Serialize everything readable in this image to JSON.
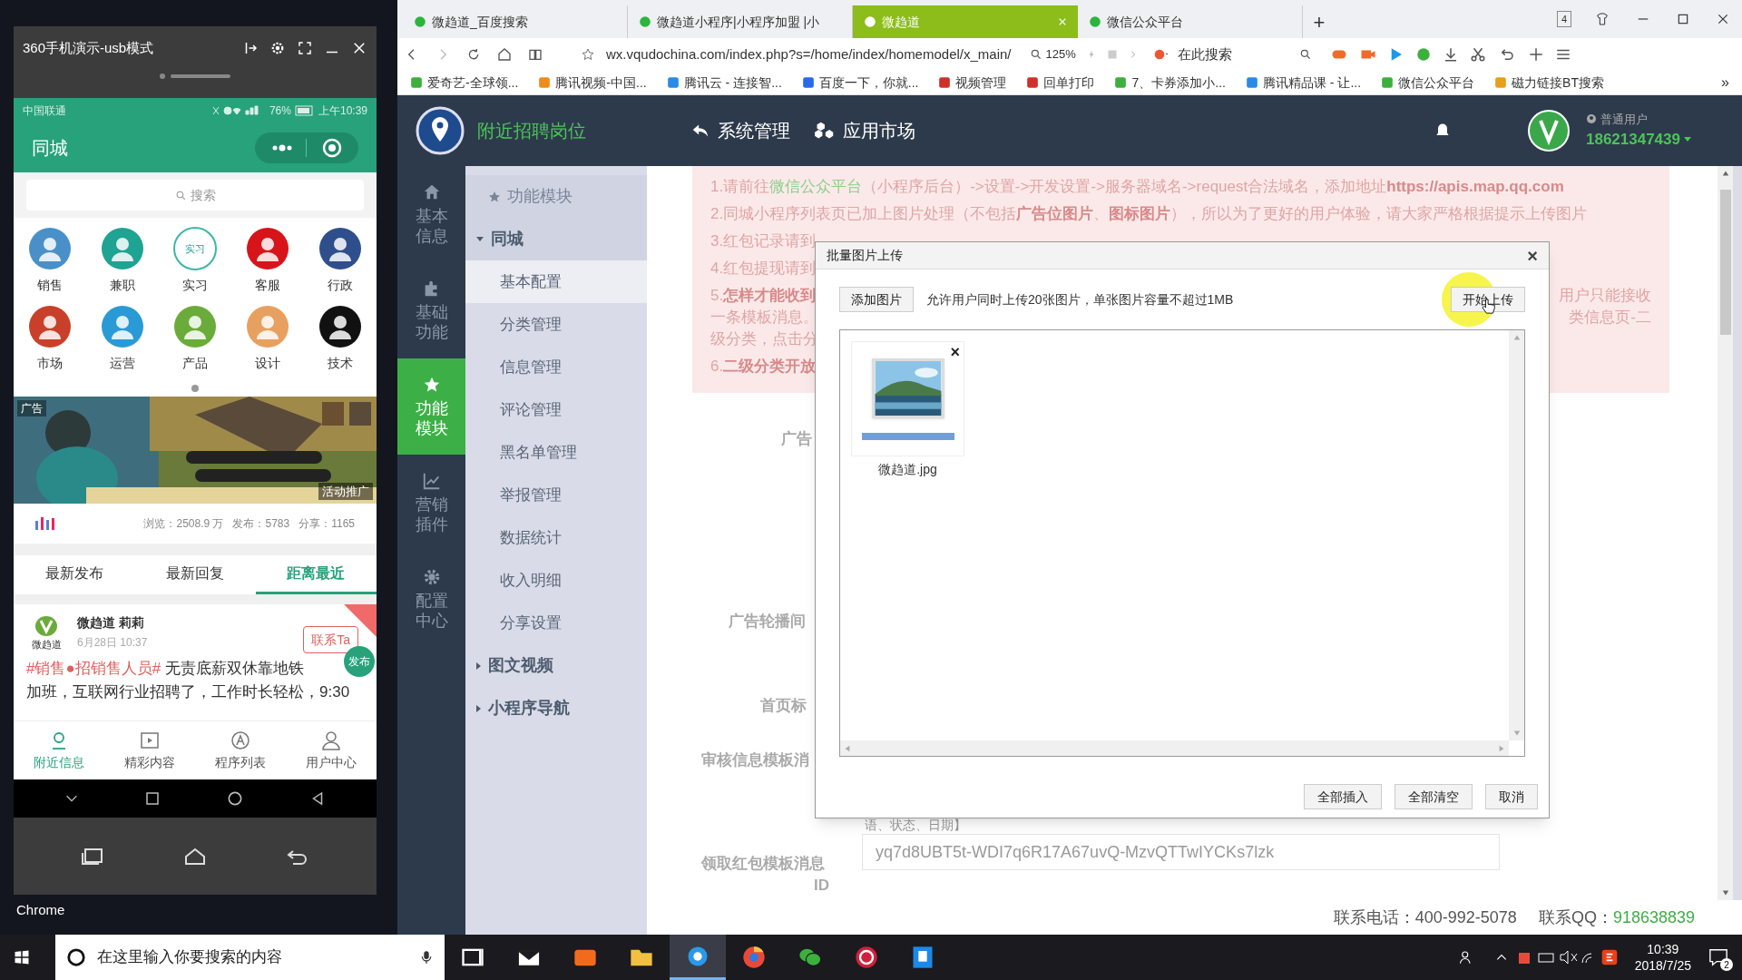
{
  "desktop": {
    "icon_labels": [
      "Chrome"
    ]
  },
  "phone_window": {
    "title": "360手机演示-usb模式",
    "status_bar": {
      "carrier": "中国联通",
      "battery": "76%",
      "time": "上午10:39"
    },
    "app_title": "同城",
    "search": {
      "placeholder": "搜索"
    },
    "categories": [
      {
        "label": "销售"
      },
      {
        "label": "兼职"
      },
      {
        "label": "实习",
        "icon_text": "实习"
      },
      {
        "label": "客服"
      },
      {
        "label": "行政"
      },
      {
        "label": "市场"
      },
      {
        "label": "运营"
      },
      {
        "label": "产品"
      },
      {
        "label": "设计"
      },
      {
        "label": "技术"
      }
    ],
    "banner": {
      "kind": "picture",
      "ad_label": "广告",
      "promo_label": "活动推广"
    },
    "stats": "浏览：2508.9 万   发布：5783   分享：1165",
    "tabs": [
      {
        "label": "最新发布",
        "selected": false
      },
      {
        "label": "最新回复",
        "selected": false
      },
      {
        "label": "距离最近",
        "selected": true
      }
    ],
    "post": {
      "logo_caption": "微趋道",
      "author": "微趋道 莉莉",
      "time": "6月28日 10:37",
      "contact_button": "联系Ta",
      "tag": "#销售●招销售人员#",
      "text_line_1": " 无责底薪双休靠地铁",
      "text_line_2": "加班，互联网行业招聘了，工作时长轻松，9:30"
    },
    "fab": "发布",
    "bottom_nav": [
      {
        "label": "附近信息",
        "selected": true
      },
      {
        "label": "精彩内容",
        "selected": false
      },
      {
        "label": "程序列表",
        "selected": false
      },
      {
        "label": "用户中心",
        "selected": false
      }
    ]
  },
  "browser": {
    "tabs": [
      {
        "title": "微趋道_百度搜索",
        "selected": false
      },
      {
        "title": "微趋道小程序|小程序加盟 |小",
        "selected": false
      },
      {
        "title": "微趋道",
        "selected": true
      },
      {
        "title": "微信公众平台",
        "selected": false
      }
    ],
    "new_tab": "+",
    "tab_count": "4",
    "url": "wx.vqudochina.com/index.php?s=/home/index/homemodel/x_main/",
    "zoom": "125%",
    "search_placeholder": "在此搜索",
    "bookmarks": [
      "爱奇艺-全球领...",
      "腾讯视频-中国...",
      "腾讯云 - 连接智...",
      "百度一下，你就...",
      "视频管理",
      "回单打印",
      "7、卡券添加小...",
      "腾讯精品课 - 让...",
      "微信公众平台",
      "磁力链接BT搜索"
    ],
    "bookmarks_more": "»"
  },
  "admin": {
    "brand": "附近招聘岗位",
    "top_nav": [
      "系统管理",
      "应用市场"
    ],
    "user_role": "普通用户",
    "user_phone": "18621347439",
    "side_nav": [
      {
        "label": "基本信息",
        "selected": false
      },
      {
        "label": "基础功能",
        "selected": false
      },
      {
        "label": "功能模块",
        "selected": true
      },
      {
        "label": "营销插件",
        "selected": false
      },
      {
        "label": "配置中心",
        "selected": false
      }
    ],
    "sub_nav": {
      "title": "功能模块",
      "groups": [
        {
          "label": "同城",
          "expanded": true,
          "children": [
            {
              "label": "基本配置",
              "selected": true
            },
            {
              "label": "分类管理",
              "selected": false
            },
            {
              "label": "信息管理",
              "selected": false
            },
            {
              "label": "评论管理",
              "selected": false
            },
            {
              "label": "黑名单管理",
              "selected": false
            },
            {
              "label": "举报管理",
              "selected": false
            },
            {
              "label": "数据统计",
              "selected": false
            },
            {
              "label": "收入明细",
              "selected": false
            },
            {
              "label": "分享设置",
              "selected": false
            }
          ]
        },
        {
          "label": "图文视频",
          "expanded": false
        },
        {
          "label": "小程序导航",
          "expanded": false
        }
      ]
    },
    "notices": [
      {
        "parts": [
          {
            "kind": "plain",
            "text": "1.请前往"
          },
          {
            "kind": "link",
            "text": "微信公众平台"
          },
          {
            "kind": "plain",
            "text": "（小程序后台）->设置->开发设置->服务器域名->request合法域名，添加地址"
          },
          {
            "kind": "bold",
            "text": "https://apis.map.qq.com"
          }
        ]
      },
      {
        "parts": [
          {
            "kind": "plain",
            "text": "2.同城小程序列表页已加上图片处理（不包括"
          },
          {
            "kind": "bold",
            "text": "广告位图片"
          },
          {
            "kind": "plain",
            "text": "、"
          },
          {
            "kind": "bold",
            "text": "图标图片"
          },
          {
            "kind": "plain",
            "text": "），所以为了更好的用户体验，请大家严格根据提示上传图片"
          }
        ]
      },
      {
        "parts": [
          {
            "kind": "plain",
            "text": "3.红包记录请到"
          }
        ]
      },
      {
        "parts": [
          {
            "kind": "plain",
            "text": "4.红包提现请到"
          }
        ]
      },
      {
        "parts": [
          {
            "kind": "plain",
            "text": "5."
          },
          {
            "kind": "bold",
            "text": "怎样才能收到"
          }
        ],
        "right": "用户只能接收"
      },
      {
        "parts": [
          {
            "kind": "plain",
            "text": "一条模板消息。"
          }
        ],
        "right": "类信息页-二"
      },
      {
        "parts": [
          {
            "kind": "plain",
            "text": "级分类，点击分"
          }
        ]
      },
      {
        "parts": [
          {
            "kind": "plain",
            "text": "6."
          },
          {
            "kind": "bold",
            "text": "二级分类开放"
          }
        ]
      }
    ],
    "form": {
      "label_1": "广告",
      "label_2": "广告轮播间",
      "label_3": "首页标",
      "label_4": "审核信息模板消",
      "hint": "语、状态、日期】",
      "label_5": "领取红包模板消息",
      "label_5b": "ID",
      "input_value": "yq7d8UBT5t-WDI7q6R17A67uvQ-MzvQTTwIYCKs7lzk"
    },
    "footer": {
      "phone": "联系电话：400-992-5078",
      "qq_label": "联系QQ：",
      "qq": "918638839"
    }
  },
  "dialog": {
    "title": "批量图片上传",
    "close": "×",
    "add_button": "添加图片",
    "hint": "允许用户同时上传20张图片，单张图片容量不超过1MB",
    "start_button": "开始上传",
    "files": [
      {
        "name": "微趋道.jpg",
        "remove": "×",
        "level": 1
      }
    ],
    "buttons": [
      "全部插入",
      "全部清空",
      "取消"
    ]
  },
  "taskbar": {
    "search_placeholder": "在这里输入你要搜索的内容",
    "time": "10:39",
    "date": "2018/7/25",
    "notifications": "2"
  }
}
